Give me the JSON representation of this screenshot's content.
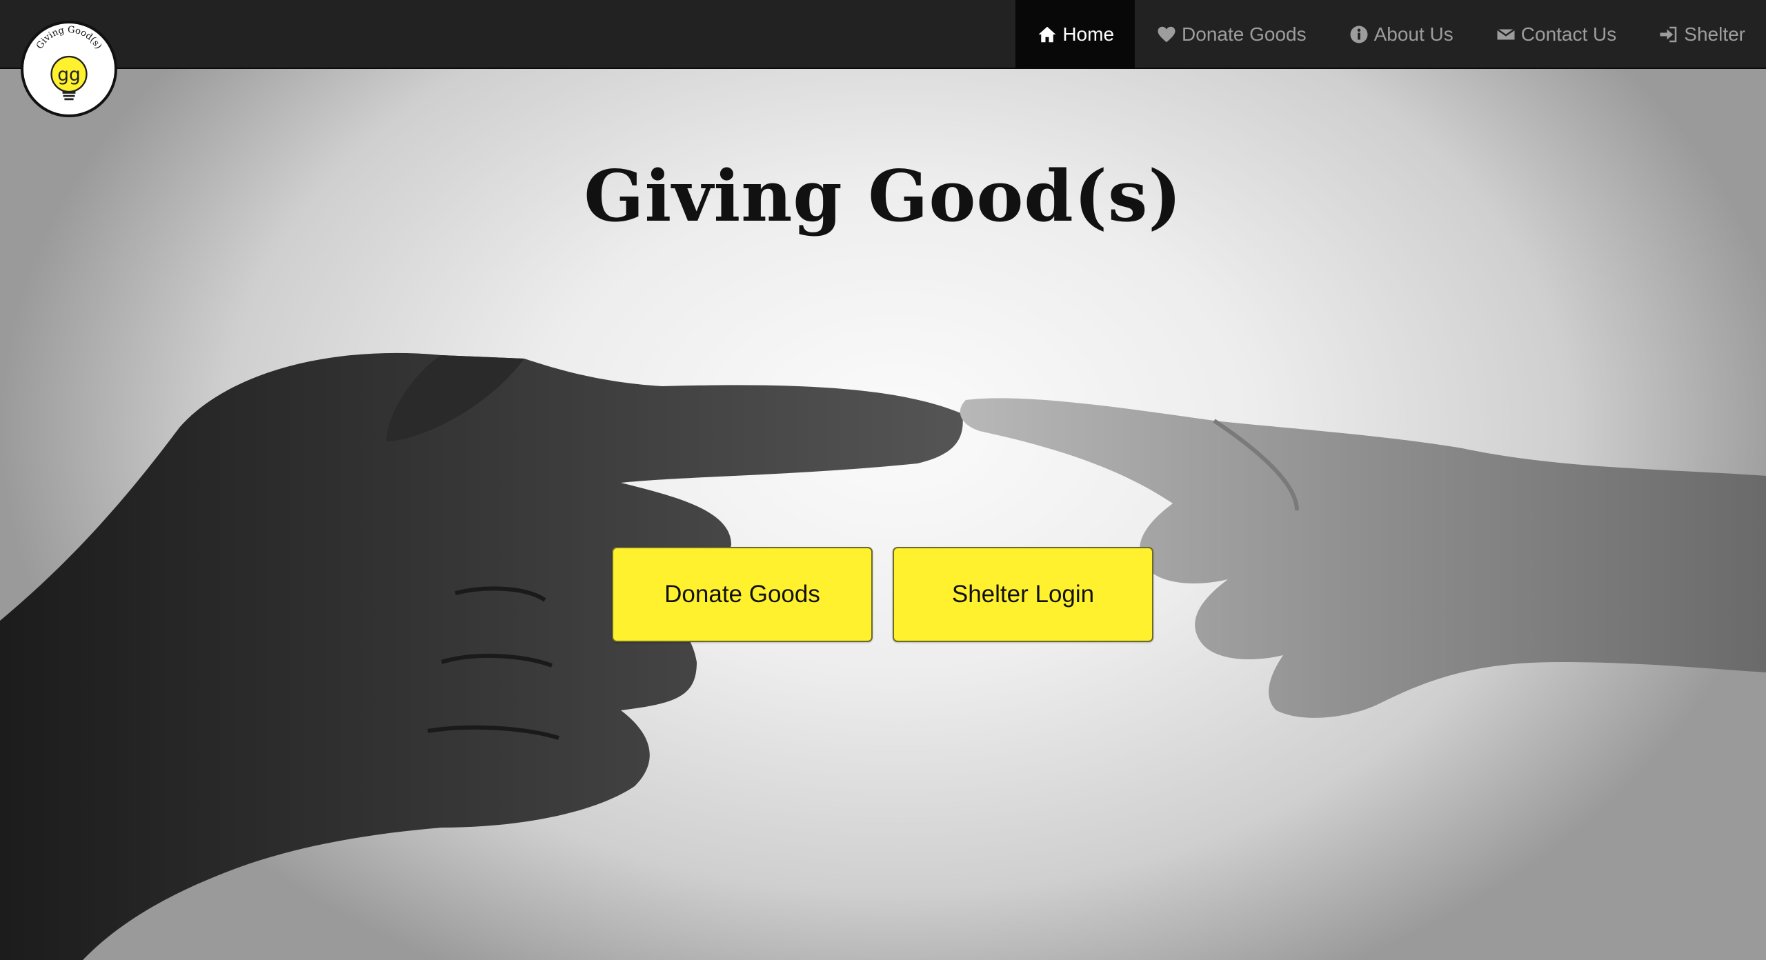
{
  "logo": {
    "text": "Giving Good(s)",
    "monogram": "gg"
  },
  "nav": {
    "items": [
      {
        "label": "Home",
        "icon": "home-icon",
        "active": true
      },
      {
        "label": "Donate Goods",
        "icon": "heart-icon",
        "active": false
      },
      {
        "label": "About Us",
        "icon": "info-icon",
        "active": false
      },
      {
        "label": "Contact Us",
        "icon": "envelope-icon",
        "active": false
      },
      {
        "label": "Shelter",
        "icon": "login-icon",
        "active": false
      }
    ]
  },
  "hero": {
    "title": "Giving Good(s)",
    "donate_button": "Donate Goods",
    "shelter_button": "Shelter Login"
  },
  "colors": {
    "navbar": "#222222",
    "nav_active": "#080808",
    "nav_text": "#9d9d9d",
    "button_accent": "#fff12e"
  }
}
